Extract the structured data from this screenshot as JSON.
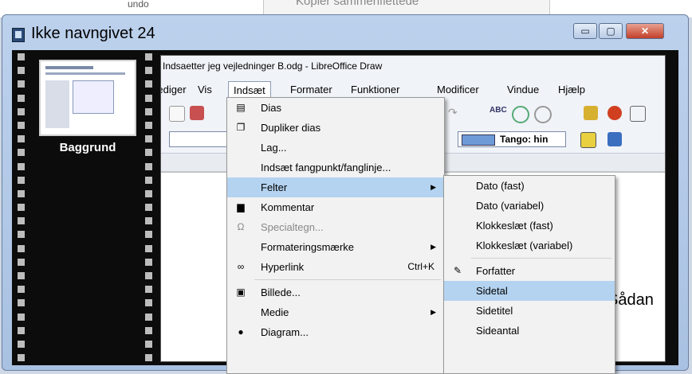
{
  "background": {
    "ghost_menu_text": "Kopier sammenflettede",
    "ghost_left_text": "undo"
  },
  "window": {
    "title": "Ikke navngivet 24",
    "min_glyph": "▭",
    "max_glyph": "▢",
    "close_glyph": "✕"
  },
  "sidebar": {
    "slide_label": "Baggrund"
  },
  "app": {
    "title": "Indsaetter jeg vejledninger B.odg - LibreOffice Draw",
    "menus": [
      "Rediger",
      "Vis",
      "Indsæt",
      "Formater",
      "Funktioner",
      "Modificer",
      "Vindue",
      "Hjælp"
    ],
    "active_menu": "Indsæt",
    "toolbar": {
      "color_name": "Tango: hin",
      "spell_label": "ABC"
    },
    "canvas_text": "Sådan"
  },
  "insert_menu": {
    "items": [
      {
        "label": "Dias",
        "icon": "slide-icon",
        "glyph": "▤"
      },
      {
        "label": "Dupliker dias",
        "icon": "duplicate-slide-icon",
        "glyph": "❐"
      },
      {
        "label": "Lag...",
        "icon": "",
        "glyph": ""
      },
      {
        "label": "Indsæt fangpunkt/fanglinje...",
        "icon": "",
        "glyph": ""
      },
      {
        "label": "Felter",
        "icon": "",
        "glyph": "",
        "submenu": true
      },
      {
        "label": "Kommentar",
        "icon": "comment-icon",
        "glyph": "▆"
      },
      {
        "label": "Specialtegn...",
        "icon": "omega-icon",
        "glyph": "Ω",
        "disabled": true
      },
      {
        "label": "Formateringsmærke",
        "icon": "",
        "glyph": "",
        "submenu": true
      },
      {
        "label": "Hyperlink",
        "icon": "hyperlink-icon",
        "glyph": "∞",
        "shortcut": "Ctrl+K"
      },
      {
        "label": "Billede...",
        "icon": "image-icon",
        "glyph": "▣"
      },
      {
        "label": "Medie",
        "icon": "",
        "glyph": "",
        "submenu": true
      },
      {
        "label": "Diagram...",
        "icon": "chart-icon",
        "glyph": "●"
      }
    ]
  },
  "fields_submenu": {
    "items": [
      {
        "label": "Dato (fast)"
      },
      {
        "label": "Dato (variabel)"
      },
      {
        "label": "Klokkeslæt (fast)"
      },
      {
        "label": "Klokkeslæt (variabel)"
      },
      {
        "label": "Forfatter",
        "icon": "author-icon",
        "glyph": "✎"
      },
      {
        "label": "Sidetal",
        "selected": true
      },
      {
        "label": "Sidetitel"
      },
      {
        "label": "Sideantal"
      }
    ]
  },
  "colors": {
    "selection": "#b4d3f0",
    "close_button": "#c2402a",
    "film": "#0c0c0c"
  }
}
